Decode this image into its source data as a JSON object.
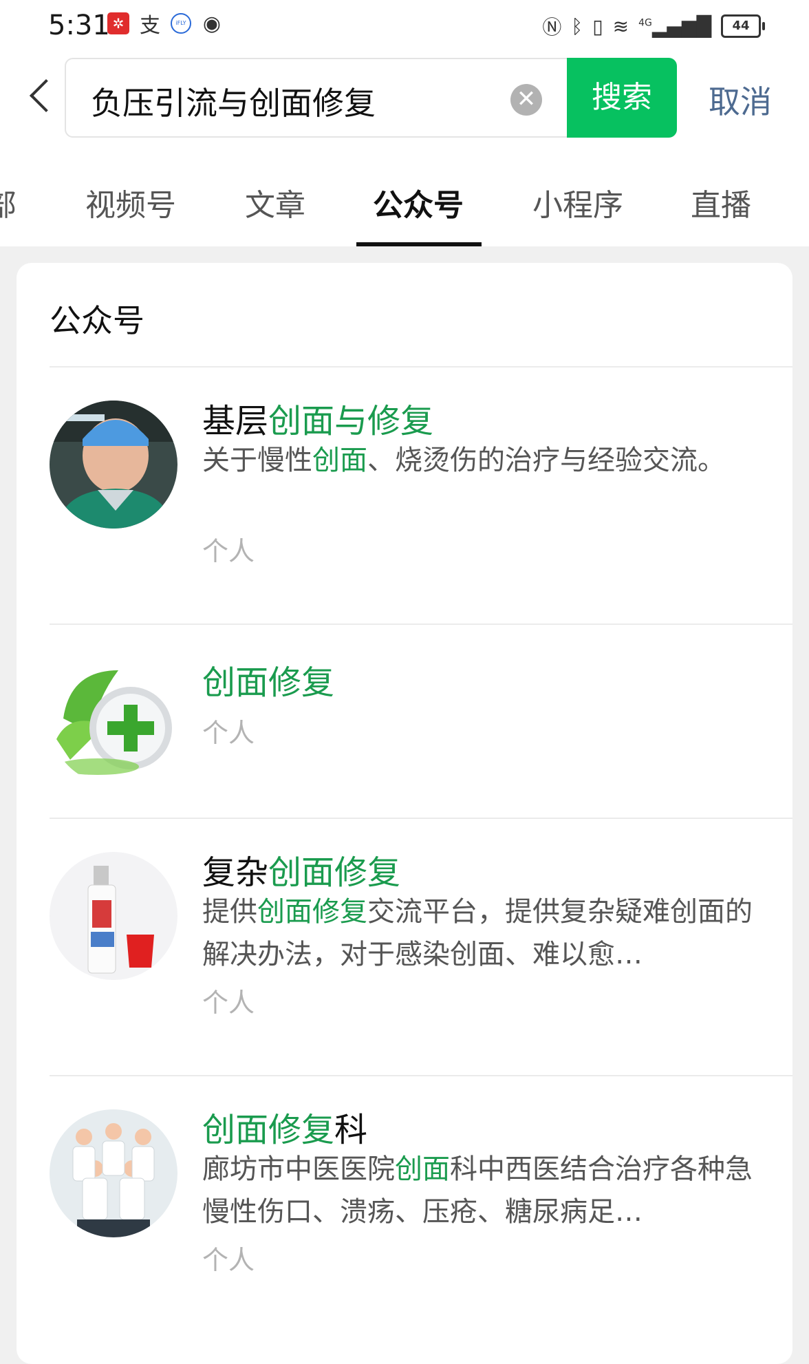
{
  "status_bar": {
    "time": "5:31",
    "left_icons": [
      "app-red-icon",
      "alipay-icon",
      "ifly-icon",
      "eye-icon"
    ],
    "zhi_glyph": "支",
    "ifly_label": "iFLY",
    "right_icons": [
      "nfc-icon",
      "bluetooth-icon",
      "vibrate-icon",
      "wifi-icon",
      "signal-4g-icon"
    ],
    "network": "4G",
    "battery": "44"
  },
  "search": {
    "query": "负压引流与创面修复",
    "clear_symbol": "✕",
    "search_label": "搜索",
    "cancel_label": "取消"
  },
  "tabs": [
    {
      "label": "部",
      "active": false
    },
    {
      "label": "视频号",
      "active": false
    },
    {
      "label": "文章",
      "active": false
    },
    {
      "label": "公众号",
      "active": true
    },
    {
      "label": "小程序",
      "active": false
    },
    {
      "label": "直播",
      "active": false
    }
  ],
  "section": {
    "title": "公众号"
  },
  "results": [
    {
      "title_plain": "基层",
      "title_highlight": "创面与修复",
      "title_tail": "",
      "desc_lead": "关于慢性",
      "desc_highlight": "创面",
      "desc_tail": "、烧烫伤的治疗与经验交流。",
      "type": "个人"
    },
    {
      "title_plain": "",
      "title_highlight": "创面修复",
      "title_tail": "",
      "type": "个人"
    },
    {
      "title_plain": "复杂",
      "title_highlight": "创面修复",
      "title_tail": "",
      "desc_lead": "提供",
      "desc_highlight": "创面修复",
      "desc_tail": "交流平台，提供复杂疑难创面的解决办法，对于感染创面、难以愈…",
      "type": "个人"
    },
    {
      "title_plain": "",
      "title_highlight": "创面修复",
      "title_tail": "科",
      "desc_lead": "廊坊市中医医院",
      "desc_highlight": "创面",
      "desc_tail": "科中西医结合治疗各种急慢性伤口、溃疡、压疮、糖尿病足…",
      "type": "个人"
    }
  ],
  "colors": {
    "accent": "#07c160",
    "highlight": "#1a9b4e",
    "link": "#4d6a90"
  }
}
